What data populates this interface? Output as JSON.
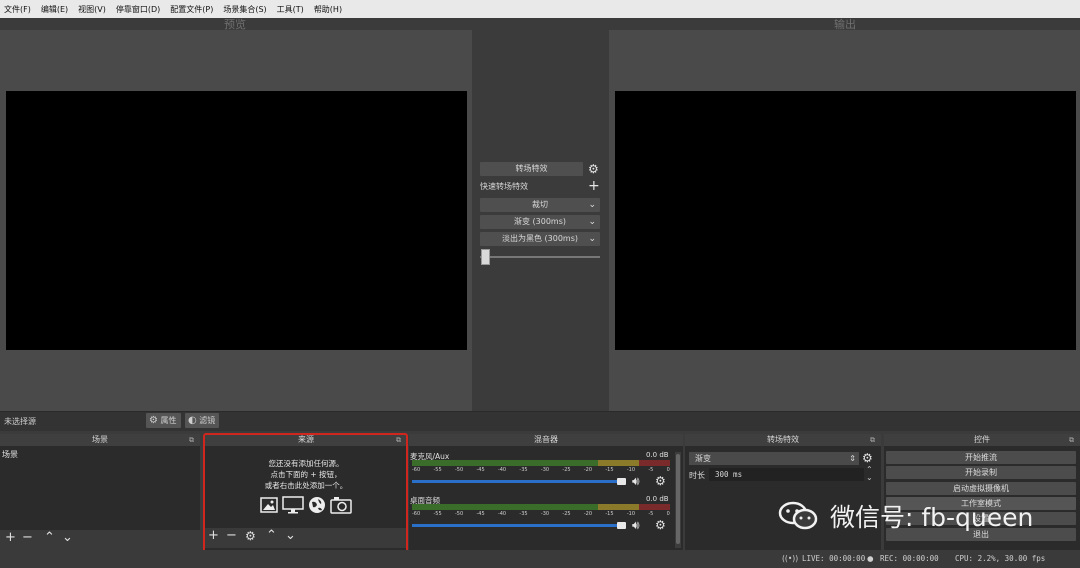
{
  "menu": [
    "文件(F)",
    "编辑(E)",
    "视图(V)",
    "停靠窗口(D)",
    "配置文件(P)",
    "场景集合(S)",
    "工具(T)",
    "帮助(H)"
  ],
  "preview": {
    "title": "预览"
  },
  "output": {
    "title": "输出"
  },
  "transition_panel": {
    "transition_button": "转场特效",
    "quick_label": "快速转场特效",
    "cut_label": "裁切",
    "fade_label": "渐变 (300ms)",
    "fade_black_label": "淡出为黑色 (300ms)",
    "slider_value": 0
  },
  "status_strip": {
    "no_source": "未选择源",
    "properties": "属性",
    "filters": "滤镜"
  },
  "docks": {
    "scenes": {
      "title": "场景",
      "items": [
        "场景"
      ]
    },
    "sources": {
      "title": "来源",
      "empty_line1": "您还没有添加任何源。",
      "empty_line2": "点击下面的 + 按钮，",
      "empty_line3": "或者右击此处添加一个。"
    },
    "mixer": {
      "title": "混音器",
      "channels": [
        {
          "name": "麦克风/Aux",
          "db": "0.0 dB"
        },
        {
          "name": "桌面音频",
          "db": "0.0 dB"
        }
      ],
      "ticks": [
        "-60",
        "-55",
        "-50",
        "-45",
        "-40",
        "-35",
        "-30",
        "-25",
        "-20",
        "-15",
        "-10",
        "-5",
        "0"
      ]
    },
    "transitions": {
      "title": "转场特效",
      "selected": "渐变",
      "duration_label": "时长",
      "duration_value": "300 ms"
    },
    "controls": {
      "title": "控件",
      "buttons": [
        "开始推流",
        "开始录制",
        "启动虚拟摄像机",
        "工作室模式",
        "设置",
        "退出"
      ]
    }
  },
  "bottom_status": {
    "live": "LIVE: 00:00:00",
    "rec": "REC: 00:00:00",
    "cpu": "CPU: 2.2%, 30.00 fps"
  },
  "watermark": {
    "text": "微信号: fb-queen"
  }
}
